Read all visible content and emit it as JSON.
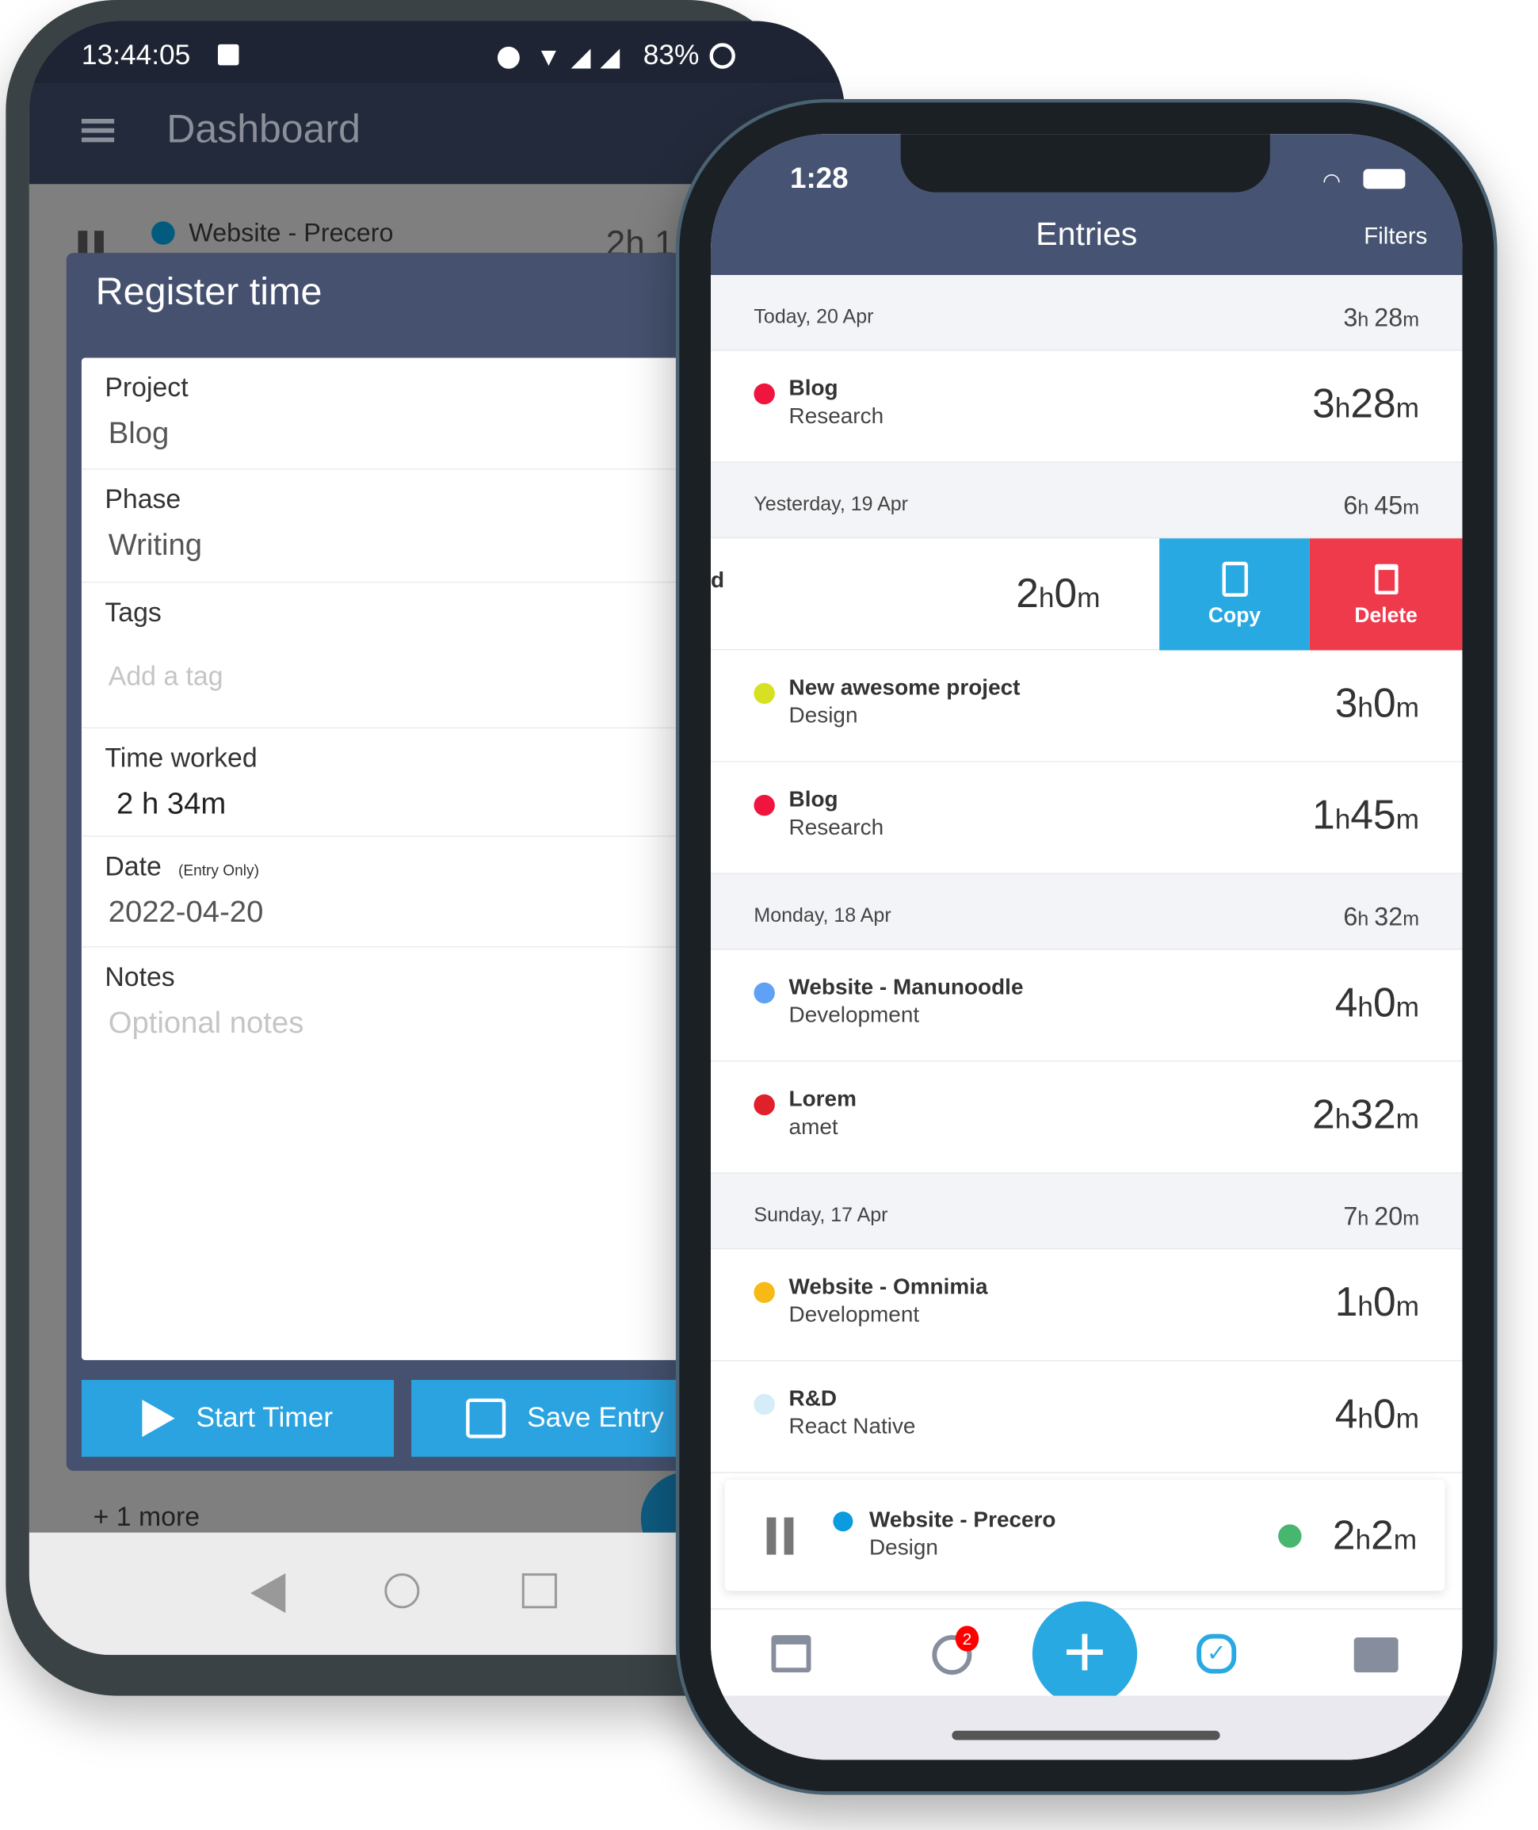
{
  "android": {
    "status": {
      "time": "13:44:05",
      "battery": "83%",
      "icons": [
        "image-icon",
        "dnd-icon",
        "wifi-icon",
        "signal-icon",
        "signal-icon",
        "battery-ring-icon"
      ]
    },
    "appbar": {
      "title": "Dashboard",
      "menu_icon": "hamburger-icon"
    },
    "background_entry": {
      "project": "Website - Precero",
      "duration": "2h 1",
      "color": "#005b7f"
    },
    "dialog": {
      "title": "Register time",
      "fields": {
        "project": {
          "label": "Project",
          "value": "Blog"
        },
        "phase": {
          "label": "Phase",
          "value": "Writing"
        },
        "tags": {
          "label": "Tags",
          "placeholder": "Add a tag"
        },
        "time": {
          "label": "Time worked",
          "hours": "2",
          "h": "h",
          "minutes": "34m"
        },
        "date": {
          "label": "Date",
          "note": "(Entry Only)",
          "value": "2022-04-20"
        },
        "notes": {
          "label": "Notes",
          "placeholder": "Optional notes"
        }
      },
      "start_timer": "Start Timer",
      "save_entry": "Save Entry"
    },
    "more": "+ 1 more"
  },
  "iphone": {
    "status": {
      "time": "1:28"
    },
    "header": {
      "title": "Entries",
      "filters": "Filters"
    },
    "days": [
      {
        "label": "Today, 20 Apr",
        "h": "3",
        "m": "28",
        "entries": [
          {
            "project": "Blog",
            "phase": "Research",
            "h": "3",
            "m": "28",
            "color": "#f0153e"
          }
        ]
      },
      {
        "label": "Yesterday, 19 Apr",
        "h": "6",
        "m": "45",
        "entries": [
          {
            "project": "New awesome project",
            "phase": "Design",
            "h": "3",
            "m": "0",
            "color": "#d8e022"
          },
          {
            "project": "Blog",
            "phase": "Research",
            "h": "1",
            "m": "45",
            "color": "#f0153e"
          }
        ]
      },
      {
        "label": "Monday, 18 Apr",
        "h": "6",
        "m": "32",
        "entries": [
          {
            "project": "Website - Manunoodle",
            "phase": "Development",
            "h": "4",
            "m": "0",
            "color": "#5fa2f5"
          },
          {
            "project": "Lorem",
            "phase": "amet",
            "h": "2",
            "m": "32",
            "color": "#e0202a"
          }
        ]
      },
      {
        "label": "Sunday, 17 Apr",
        "h": "7",
        "m": "20",
        "entries": [
          {
            "project": "Website - Omnimia",
            "phase": "Development",
            "h": "1",
            "m": "0",
            "color": "#f7b915"
          },
          {
            "project": "R&D",
            "phase": "React Native",
            "h": "4",
            "m": "0",
            "color": "#d6ecf8"
          }
        ]
      }
    ],
    "swiped_row": {
      "partial_text": "d",
      "h": "2",
      "m": "0",
      "copy": "Copy",
      "delete": "Delete",
      "copy_color": "#29a9e1",
      "delete_color": "#ef3a4c"
    },
    "running": {
      "project": "Website - Precero",
      "phase": "Design",
      "h": "2",
      "m": "2",
      "color": "#0a9be0",
      "status_color": "#47b76f"
    },
    "tabbar": {
      "badge": "2",
      "icons": [
        "calendar-icon",
        "clock-icon",
        "plus-icon",
        "verified-badge-icon",
        "folder-icon"
      ],
      "accent": "#29a9e1"
    }
  }
}
